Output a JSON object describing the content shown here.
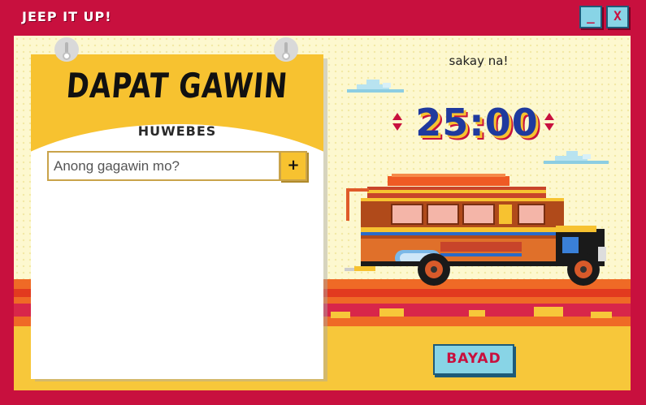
{
  "app": {
    "title": "JEEP IT UP!",
    "minimize_label": "_",
    "close_label": "X"
  },
  "notepad": {
    "title": "DAPAT GAWIN",
    "day": "HUWEBES",
    "input_placeholder": "Anong gagawin mo?",
    "input_value": "",
    "add_label": "+"
  },
  "timer": {
    "subtitle": "sakay na!",
    "display": "25:00"
  },
  "actions": {
    "pay_label": "BAYAD"
  },
  "colors": {
    "frame": "#c8103e",
    "button_bg": "#88d4e6",
    "notepad_header": "#f7c230",
    "timer_text": "#1f3a9e",
    "background": "#fdf8cf"
  },
  "icons": {
    "timer_increase": "triangle-up",
    "timer_decrease": "triangle-down",
    "add_task": "plus"
  }
}
